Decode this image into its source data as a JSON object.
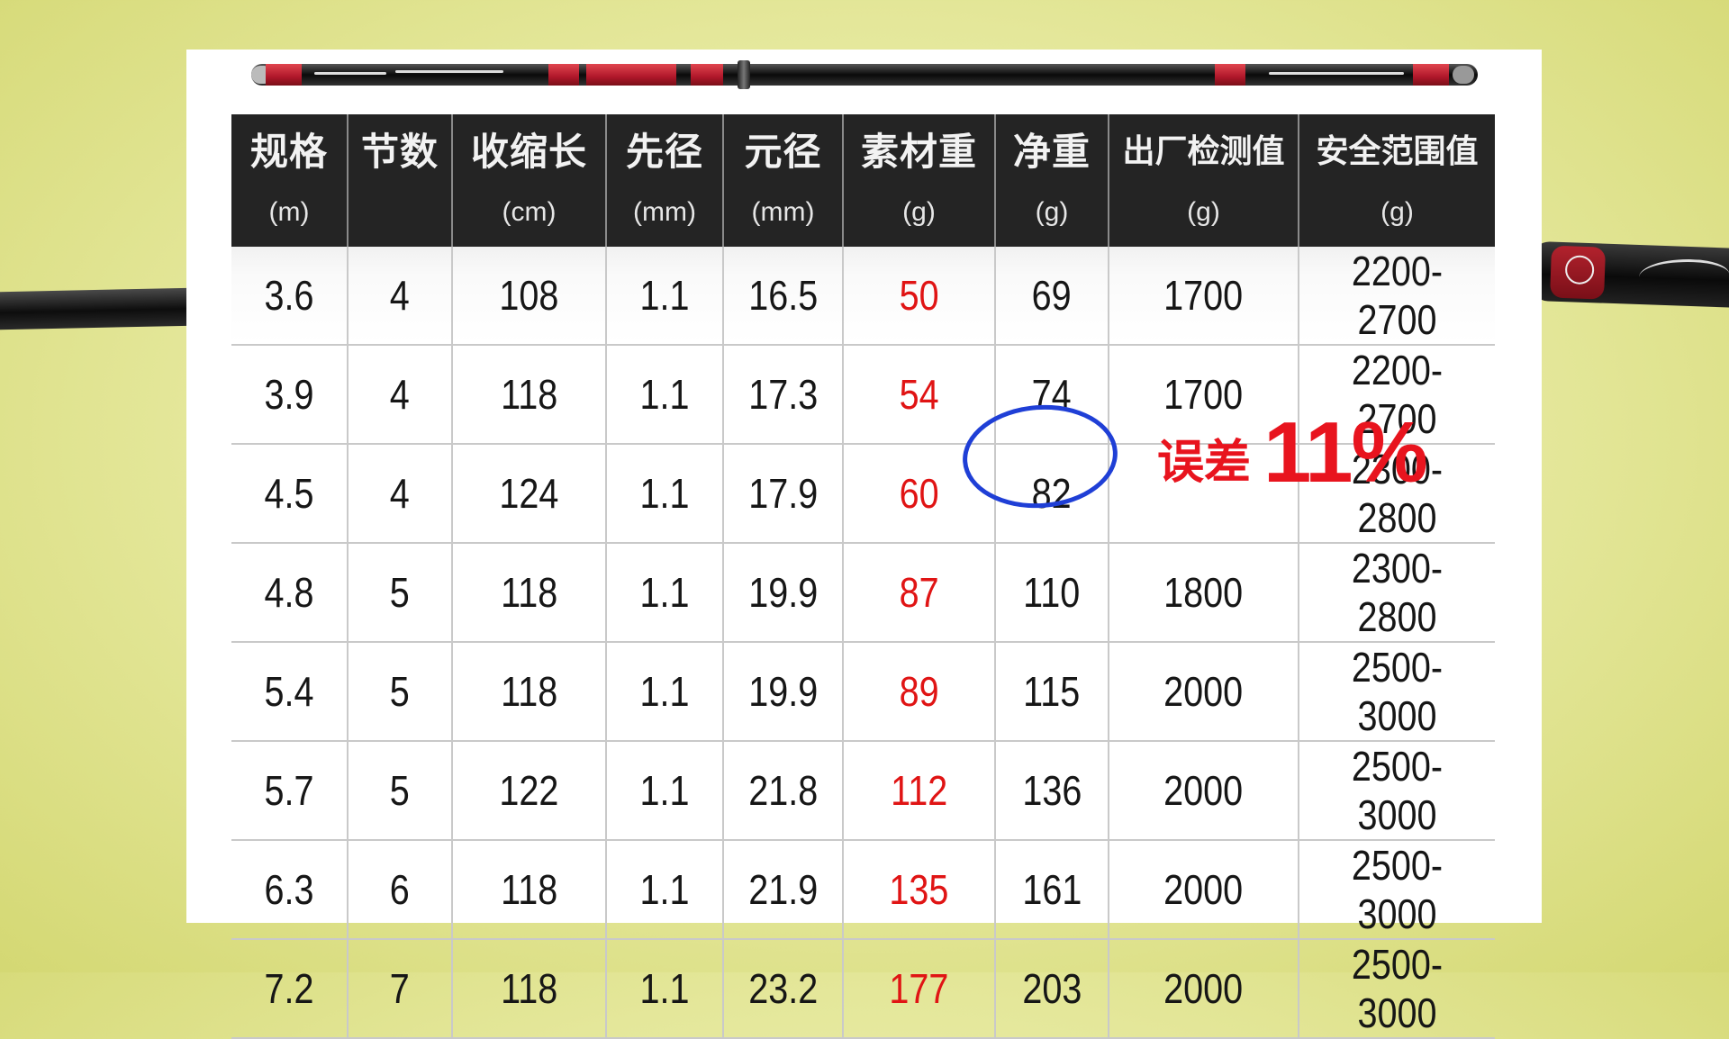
{
  "table": {
    "headers": [
      {
        "name": "规格",
        "unit": "(m)"
      },
      {
        "name": "节数",
        "unit": ""
      },
      {
        "name": "收缩长",
        "unit": "(cm)"
      },
      {
        "name": "先径",
        "unit": "(mm)"
      },
      {
        "name": "元径",
        "unit": "(mm)"
      },
      {
        "name": "素材重",
        "unit": "(g)"
      },
      {
        "name": "净重",
        "unit": "(g)"
      },
      {
        "name": "出厂检测值",
        "unit": "(g)"
      },
      {
        "name": "安全范围值",
        "unit": "(g)"
      }
    ],
    "rows": [
      [
        "3.6",
        "4",
        "108",
        "1.1",
        "16.5",
        "50",
        "69",
        "1700",
        "2200-2700"
      ],
      [
        "3.9",
        "4",
        "118",
        "1.1",
        "17.3",
        "54",
        "74",
        "1700",
        "2200-2700"
      ],
      [
        "4.5",
        "4",
        "124",
        "1.1",
        "17.9",
        "60",
        "82",
        "",
        "2300-2800"
      ],
      [
        "4.8",
        "5",
        "118",
        "1.1",
        "19.9",
        "87",
        "110",
        "1800",
        "2300-2800"
      ],
      [
        "5.4",
        "5",
        "118",
        "1.1",
        "19.9",
        "89",
        "115",
        "2000",
        "2500-3000"
      ],
      [
        "5.7",
        "5",
        "122",
        "1.1",
        "21.8",
        "112",
        "136",
        "2000",
        "2500-3000"
      ],
      [
        "6.3",
        "6",
        "118",
        "1.1",
        "21.9",
        "135",
        "161",
        "2000",
        "2500-3000"
      ],
      [
        "7.2",
        "7",
        "118",
        "1.1",
        "23.2",
        "177",
        "203",
        "2000",
        "2500-3000"
      ]
    ],
    "highlight_column_color": "#e01414"
  },
  "annotation": {
    "text": "误差",
    "value": "11%",
    "color": "#e8141e",
    "circle_color": "#1f3fd6"
  }
}
